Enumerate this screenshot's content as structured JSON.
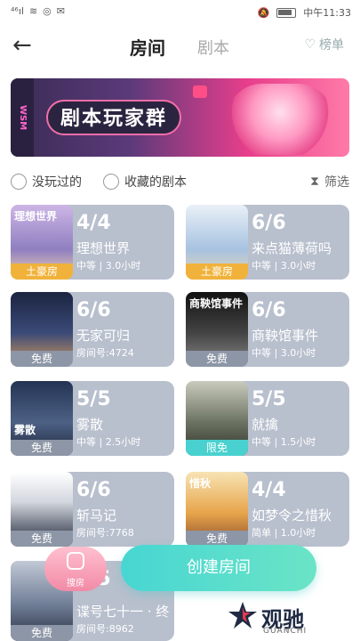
{
  "status_bar": {
    "left_text": "⁴⁶ᵢₗₗ",
    "right_time": "中午11:33"
  },
  "header": {
    "tab_rooms": "房间",
    "tab_scripts": "剧本",
    "rank_label": "榜单"
  },
  "banner": {
    "side_text": "WSM",
    "title": "剧本玩家群"
  },
  "filters": {
    "option1": "没玩过的",
    "option2": "收藏的剧本",
    "sift": "筛选"
  },
  "rooms": [
    {
      "count": "4/4",
      "name": "理想世界",
      "meta": "中等 | 3.0小时",
      "label": "土豪房",
      "cover_title": "理想世界"
    },
    {
      "count": "6/6",
      "name": "来点猫薄荷吗",
      "meta": "中等 | 3.0小时",
      "label": "土豪房",
      "cover_title": ""
    },
    {
      "count": "6/6",
      "name": "无家可归",
      "meta": "房间号:4724",
      "label": "免费",
      "cover_title": ""
    },
    {
      "count": "6/6",
      "name": "商鞅馆事件",
      "meta": "中等 | 3.0小时",
      "label": "免费",
      "cover_title": "商鞅馆事件"
    },
    {
      "count": "5/5",
      "name": "雾散",
      "meta": "中等 | 2.5小时",
      "label": "免费",
      "cover_title": "雾散"
    },
    {
      "count": "5/5",
      "name": "就擒",
      "meta": "中等 | 1.5小时",
      "label": "限免",
      "cover_title": ""
    },
    {
      "count": "6/6",
      "name": "斩马记",
      "meta": "房间号:7768",
      "label": "免费",
      "cover_title": ""
    },
    {
      "count": "4/4",
      "name": "如梦令之惜秋",
      "meta": "简单 | 1.0小时",
      "label": "免费",
      "cover_title": "惜秋"
    },
    {
      "count": "5/5",
      "name": "谍号七十一 · 终",
      "meta": "房间号:8962",
      "label": "免费",
      "cover_title": ""
    }
  ],
  "bottom": {
    "search_label": "搜房",
    "create_button": "创建房间",
    "logo_text": "观驰",
    "logo_sub": "GUANCHI"
  }
}
